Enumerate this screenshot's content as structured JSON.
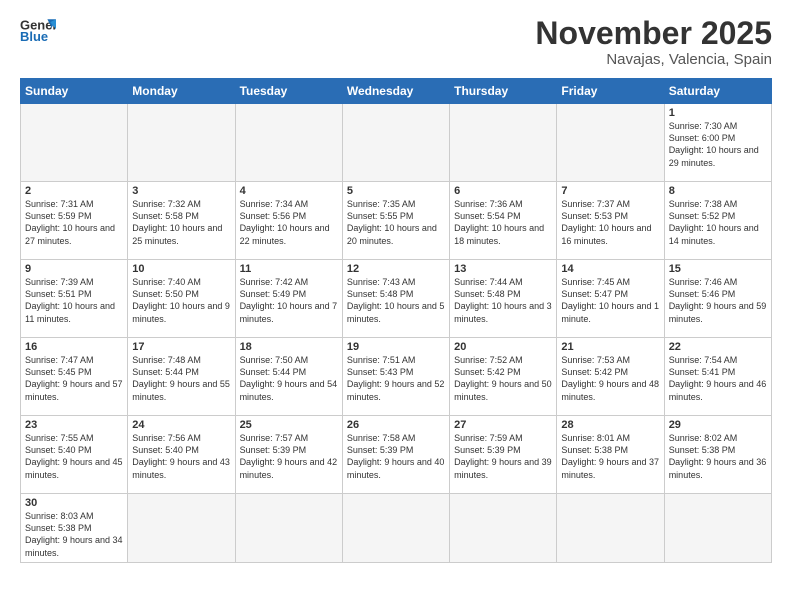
{
  "header": {
    "logo_general": "General",
    "logo_blue": "Blue",
    "month_year": "November 2025",
    "location": "Navajas, Valencia, Spain"
  },
  "weekdays": [
    "Sunday",
    "Monday",
    "Tuesday",
    "Wednesday",
    "Thursday",
    "Friday",
    "Saturday"
  ],
  "weeks": [
    [
      {
        "day": "",
        "info": ""
      },
      {
        "day": "",
        "info": ""
      },
      {
        "day": "",
        "info": ""
      },
      {
        "day": "",
        "info": ""
      },
      {
        "day": "",
        "info": ""
      },
      {
        "day": "",
        "info": ""
      },
      {
        "day": "1",
        "info": "Sunrise: 7:30 AM\nSunset: 6:00 PM\nDaylight: 10 hours\nand 29 minutes."
      }
    ],
    [
      {
        "day": "2",
        "info": "Sunrise: 7:31 AM\nSunset: 5:59 PM\nDaylight: 10 hours\nand 27 minutes."
      },
      {
        "day": "3",
        "info": "Sunrise: 7:32 AM\nSunset: 5:58 PM\nDaylight: 10 hours\nand 25 minutes."
      },
      {
        "day": "4",
        "info": "Sunrise: 7:34 AM\nSunset: 5:56 PM\nDaylight: 10 hours\nand 22 minutes."
      },
      {
        "day": "5",
        "info": "Sunrise: 7:35 AM\nSunset: 5:55 PM\nDaylight: 10 hours\nand 20 minutes."
      },
      {
        "day": "6",
        "info": "Sunrise: 7:36 AM\nSunset: 5:54 PM\nDaylight: 10 hours\nand 18 minutes."
      },
      {
        "day": "7",
        "info": "Sunrise: 7:37 AM\nSunset: 5:53 PM\nDaylight: 10 hours\nand 16 minutes."
      },
      {
        "day": "8",
        "info": "Sunrise: 7:38 AM\nSunset: 5:52 PM\nDaylight: 10 hours\nand 14 minutes."
      }
    ],
    [
      {
        "day": "9",
        "info": "Sunrise: 7:39 AM\nSunset: 5:51 PM\nDaylight: 10 hours\nand 11 minutes."
      },
      {
        "day": "10",
        "info": "Sunrise: 7:40 AM\nSunset: 5:50 PM\nDaylight: 10 hours\nand 9 minutes."
      },
      {
        "day": "11",
        "info": "Sunrise: 7:42 AM\nSunset: 5:49 PM\nDaylight: 10 hours\nand 7 minutes."
      },
      {
        "day": "12",
        "info": "Sunrise: 7:43 AM\nSunset: 5:48 PM\nDaylight: 10 hours\nand 5 minutes."
      },
      {
        "day": "13",
        "info": "Sunrise: 7:44 AM\nSunset: 5:48 PM\nDaylight: 10 hours\nand 3 minutes."
      },
      {
        "day": "14",
        "info": "Sunrise: 7:45 AM\nSunset: 5:47 PM\nDaylight: 10 hours\nand 1 minute."
      },
      {
        "day": "15",
        "info": "Sunrise: 7:46 AM\nSunset: 5:46 PM\nDaylight: 9 hours\nand 59 minutes."
      }
    ],
    [
      {
        "day": "16",
        "info": "Sunrise: 7:47 AM\nSunset: 5:45 PM\nDaylight: 9 hours\nand 57 minutes."
      },
      {
        "day": "17",
        "info": "Sunrise: 7:48 AM\nSunset: 5:44 PM\nDaylight: 9 hours\nand 55 minutes."
      },
      {
        "day": "18",
        "info": "Sunrise: 7:50 AM\nSunset: 5:44 PM\nDaylight: 9 hours\nand 54 minutes."
      },
      {
        "day": "19",
        "info": "Sunrise: 7:51 AM\nSunset: 5:43 PM\nDaylight: 9 hours\nand 52 minutes."
      },
      {
        "day": "20",
        "info": "Sunrise: 7:52 AM\nSunset: 5:42 PM\nDaylight: 9 hours\nand 50 minutes."
      },
      {
        "day": "21",
        "info": "Sunrise: 7:53 AM\nSunset: 5:42 PM\nDaylight: 9 hours\nand 48 minutes."
      },
      {
        "day": "22",
        "info": "Sunrise: 7:54 AM\nSunset: 5:41 PM\nDaylight: 9 hours\nand 46 minutes."
      }
    ],
    [
      {
        "day": "23",
        "info": "Sunrise: 7:55 AM\nSunset: 5:40 PM\nDaylight: 9 hours\nand 45 minutes."
      },
      {
        "day": "24",
        "info": "Sunrise: 7:56 AM\nSunset: 5:40 PM\nDaylight: 9 hours\nand 43 minutes."
      },
      {
        "day": "25",
        "info": "Sunrise: 7:57 AM\nSunset: 5:39 PM\nDaylight: 9 hours\nand 42 minutes."
      },
      {
        "day": "26",
        "info": "Sunrise: 7:58 AM\nSunset: 5:39 PM\nDaylight: 9 hours\nand 40 minutes."
      },
      {
        "day": "27",
        "info": "Sunrise: 7:59 AM\nSunset: 5:39 PM\nDaylight: 9 hours\nand 39 minutes."
      },
      {
        "day": "28",
        "info": "Sunrise: 8:01 AM\nSunset: 5:38 PM\nDaylight: 9 hours\nand 37 minutes."
      },
      {
        "day": "29",
        "info": "Sunrise: 8:02 AM\nSunset: 5:38 PM\nDaylight: 9 hours\nand 36 minutes."
      }
    ],
    [
      {
        "day": "30",
        "info": "Sunrise: 8:03 AM\nSunset: 5:38 PM\nDaylight: 9 hours\nand 34 minutes."
      },
      {
        "day": "",
        "info": ""
      },
      {
        "day": "",
        "info": ""
      },
      {
        "day": "",
        "info": ""
      },
      {
        "day": "",
        "info": ""
      },
      {
        "day": "",
        "info": ""
      },
      {
        "day": "",
        "info": ""
      }
    ]
  ]
}
